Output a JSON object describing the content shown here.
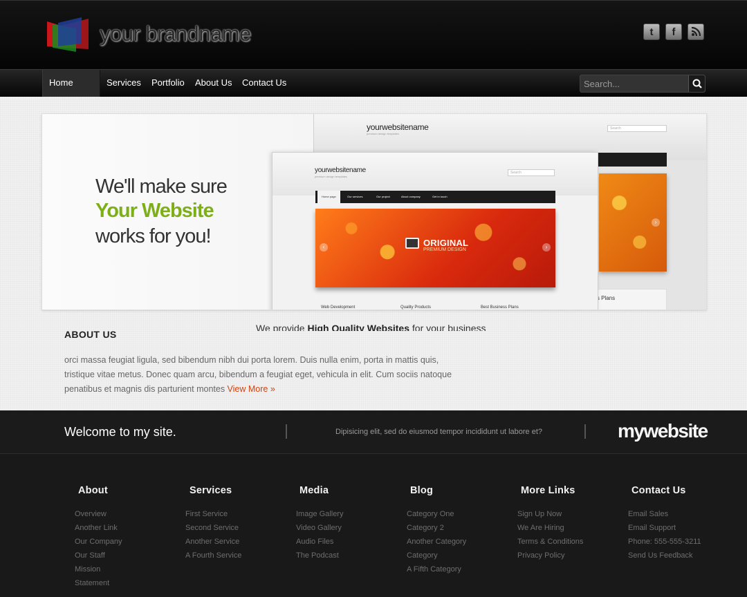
{
  "header": {
    "brand": "your brandname",
    "social": [
      {
        "icon": "twitter-icon",
        "glyph": "t"
      },
      {
        "icon": "facebook-icon",
        "glyph": "f"
      },
      {
        "icon": "rss-icon",
        "glyph": "rss"
      }
    ]
  },
  "nav": {
    "items": [
      "Home Page",
      "Services",
      "Portfolio",
      "About Us",
      "Contact Us"
    ],
    "active": 0,
    "search_placeholder": "Search..."
  },
  "hero": {
    "line1": "We'll make sure",
    "line2": "Your Website",
    "line3": "works for you!",
    "mock_title": "yourwebsitename",
    "mock_tagline": "premium design templates",
    "mock_search": "Search",
    "mock_nav": [
      "Home page",
      "Our services",
      "Our project",
      "About company",
      "Get in touch"
    ],
    "mock_banner_title": "ORIGINAL",
    "mock_banner_sub": "PREMIUM DESIGN",
    "mock_foot": [
      "Web Development",
      "Quality Products",
      "Best Business Plans"
    ],
    "mock_back_foot": "ness Plans"
  },
  "about": {
    "heading": "ABOUT US",
    "provide_pre": "We provide ",
    "provide_bold": "High Quality Websites",
    "provide_post": " for your business",
    "line1": "orci massa feugiat ligula, sed bibendum nibh dui porta lorem. Duis nulla enim, porta in mattis quis,",
    "line2": "tristique vitae metus. Donec quam arcu, bibendum a feugiat eget, vehicula in elit. Cum sociis natoque",
    "line3": "penatibus et magnis dis parturient montes ",
    "view_more": "View More »"
  },
  "band": {
    "welcome": "Welcome to my site.",
    "tagline": "Dipisicing elit, sed do eiusmod tempor incididunt ut labore et?",
    "logo": "mywebsite"
  },
  "footer": {
    "columns": [
      {
        "title": "About",
        "links": [
          "Overview",
          "Another Link",
          "Our Company",
          "Our Staff",
          "Mission",
          "Statement"
        ]
      },
      {
        "title": "Services",
        "links": [
          "First Service",
          "Second Service",
          "Another Service",
          "A Fourth Service"
        ]
      },
      {
        "title": "Media",
        "links": [
          "Image Gallery",
          "Video Gallery",
          "Audio Files",
          "The Podcast"
        ]
      },
      {
        "title": "Blog",
        "links": [
          "Category One",
          "Category 2",
          "Another Category",
          "Category",
          "A Fifth Category"
        ]
      },
      {
        "title": "More Links",
        "links": [
          "Sign Up Now",
          "We Are Hiring",
          "Terms & Conditions",
          "Privacy Policy"
        ]
      },
      {
        "title": "Contact Us",
        "links": [
          "Email Sales",
          "Email Support",
          "Phone: 555-555-3211",
          "Send Us Feedback"
        ]
      }
    ]
  },
  "colors": {
    "accent_green": "#7db018",
    "link_orange": "#d4410b",
    "header_bg": "#0a0a0a",
    "footer_bg": "#191919"
  }
}
